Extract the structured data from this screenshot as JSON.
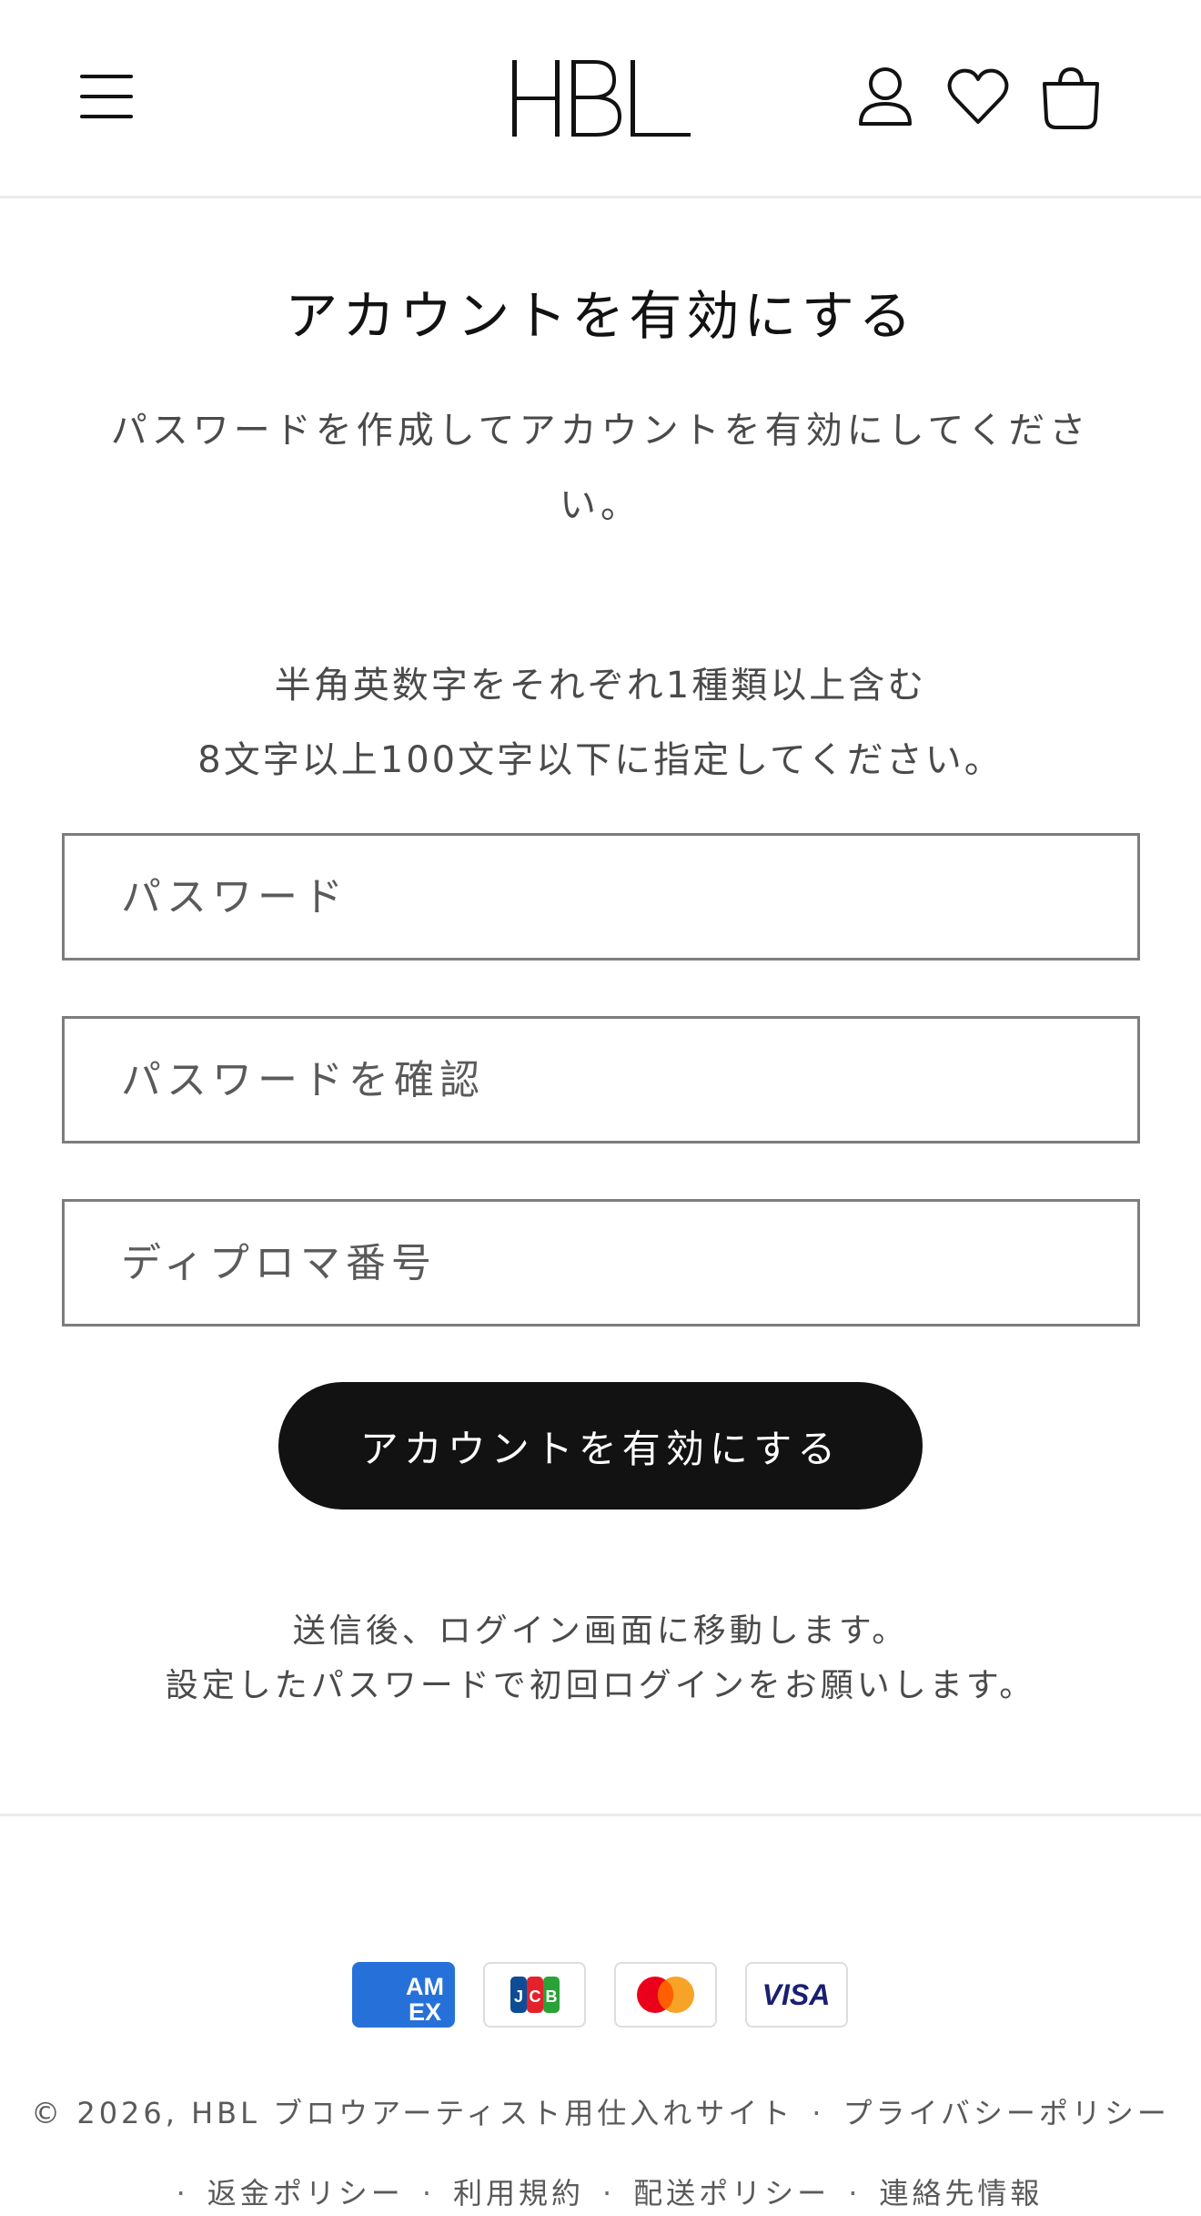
{
  "header": {
    "logo_text": "HBL",
    "menu_icon": "hamburger-menu-icon",
    "account_icon": "user-icon",
    "wishlist_icon": "heart-icon",
    "cart_icon": "shopping-bag-icon"
  },
  "main": {
    "title": "アカウントを有効にする",
    "subtitle": "パスワードを作成してアカウントを有効にしてください。",
    "rules_line1": "半角英数字をそれぞれ1種類以上含む",
    "rules_line2": "8文字以上100文字以下に指定してください。",
    "password_placeholder": "パスワード",
    "password_confirm_placeholder": "パスワードを確認",
    "diploma_placeholder": "ディプロマ番号",
    "submit_label": "アカウントを有効にする",
    "note_line1": "送信後、ログイン画面に移動します。",
    "note_line2": "設定したパスワードで初回ログインをお願いします。"
  },
  "footer": {
    "payment_methods": [
      "American Express",
      "JCB",
      "Mastercard",
      "Visa"
    ],
    "amex_label": "AM EX",
    "jcb_label": "JCB",
    "visa_label": "VISA",
    "copyright": "© 2026, HBL ブロウアーティスト用仕入れサイト",
    "links": [
      "プライバシーポリシー",
      "返金ポリシー",
      "利用規約",
      "配送ポリシー",
      "連絡先情報"
    ]
  },
  "colors": {
    "text": "#121212",
    "muted": "#4a4a4a",
    "button_bg": "#121212",
    "border": "#7d7d7d",
    "amex_blue": "#2671d9",
    "visa_navy": "#1a1f71",
    "mastercard_red": "#eb001b",
    "mastercard_orange": "#f79e1b"
  }
}
